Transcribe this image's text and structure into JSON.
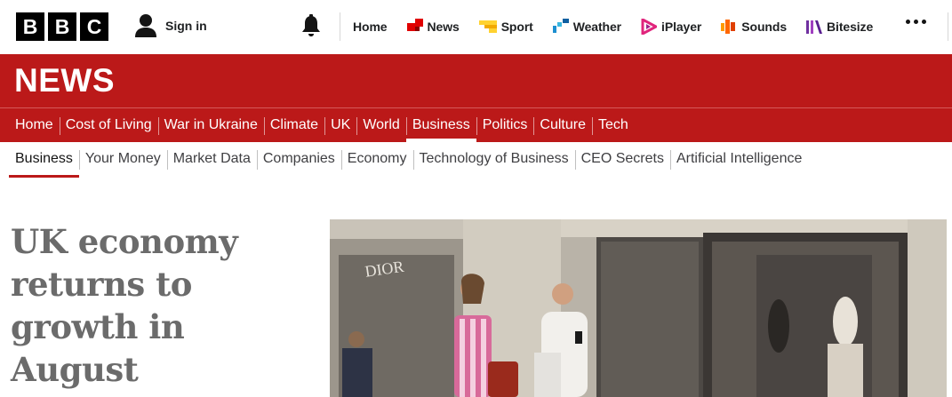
{
  "masthead": {
    "logo_letters": [
      "B",
      "B",
      "C"
    ],
    "signin_label": "Sign in",
    "nav": [
      {
        "label": "Home",
        "icon": "none"
      },
      {
        "label": "News",
        "icon": "news-icon",
        "color": "#e00000"
      },
      {
        "label": "Sport",
        "icon": "sport-icon",
        "color": "#ffd230"
      },
      {
        "label": "Weather",
        "icon": "weather-icon",
        "color": "#1d8fd0"
      },
      {
        "label": "iPlayer",
        "icon": "iplayer-icon",
        "color": "#e0247c"
      },
      {
        "label": "Sounds",
        "icon": "sounds-icon",
        "color": "#ff6600"
      },
      {
        "label": "Bitesize",
        "icon": "bitesize-icon",
        "color": "#7030a0"
      }
    ]
  },
  "banner": {
    "title": "NEWS",
    "color": "#bb1919"
  },
  "section_nav": {
    "items": [
      "Home",
      "Cost of Living",
      "War in Ukraine",
      "Climate",
      "UK",
      "World",
      "Business",
      "Politics",
      "Culture",
      "Tech"
    ],
    "active": "Business"
  },
  "sub_nav": {
    "items": [
      "Business",
      "Your Money",
      "Market Data",
      "Companies",
      "Economy",
      "Technology of Business",
      "CEO Secrets",
      "Artificial Intelligence"
    ],
    "active": "Business"
  },
  "article": {
    "headline_lines": [
      "UK economy",
      "returns to",
      "growth in",
      "August"
    ]
  }
}
